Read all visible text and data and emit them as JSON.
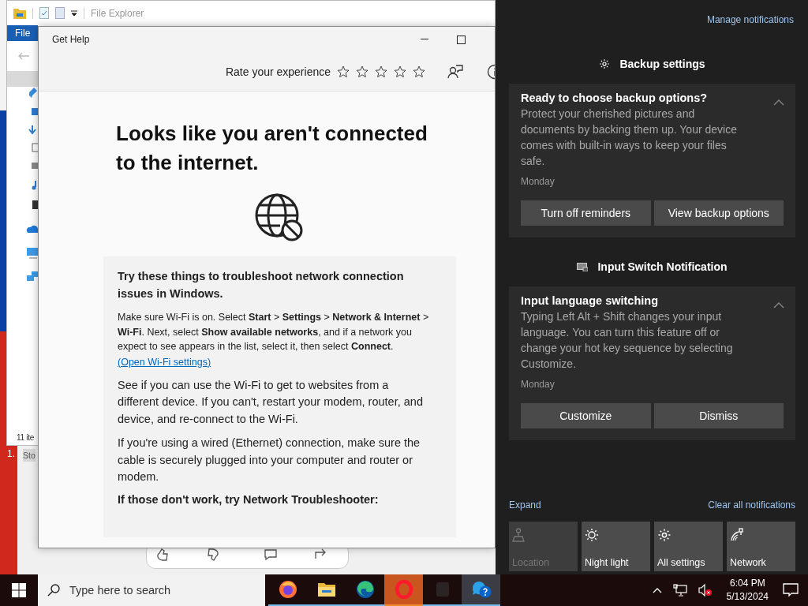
{
  "desktop": {
    "icon_label": "1."
  },
  "file_explorer": {
    "title": "File Explorer",
    "ribbon_tab": "File",
    "status": "11 ite"
  },
  "background_window": {
    "cell": "Sto"
  },
  "get_help": {
    "title": "Get Help",
    "rating": {
      "label": "Rate your experience",
      "stars": 0
    },
    "heading": "Looks like you aren't connected to the internet.",
    "card": {
      "heading": "Try these things to troubleshoot network connection issues in Windows.",
      "paragraphs": [
        {
          "kind": "small",
          "text": "Make sure Wi-Fi is on. Select **Start** > **Settings** > **Network & Internet** > **Wi-Fi**. Next, select **Show available networks**, and if a network you expect to see appears in the list, select it, then select **Connect**."
        },
        {
          "kind": "link",
          "text": "(Open Wi-Fi settings)"
        },
        {
          "kind": "body",
          "text": "See if you can use the Wi-Fi to get to websites from a different device. If you can't, restart your modem, router, and device, and re-connect to the Wi-Fi."
        },
        {
          "kind": "body",
          "text": "If you're using a wired (Ethernet) connection, make sure the cable is securely plugged into your computer and router or modem."
        },
        {
          "kind": "strong",
          "text": "If those don't work, try Network Troubleshooter:"
        }
      ]
    }
  },
  "action_center": {
    "manage": "Manage notifications",
    "groups": [
      {
        "app": "Backup settings",
        "kind": "gear",
        "notification": {
          "title": "Ready to choose backup options?",
          "body": "Protect your cherished pictures and documents by backing them up. Your device comes with built-in ways to keep your files safe.",
          "time": "Monday",
          "buttons": [
            "Turn off reminders",
            "View backup options"
          ]
        }
      },
      {
        "app": "Input Switch Notification",
        "kind": "keyboard",
        "notification": {
          "title": "Input language switching",
          "body": "Typing Left Alt + Shift changes your input language. You can turn this feature off or change your hot key sequence by selecting Customize.",
          "time": "Monday",
          "buttons": [
            "Customize",
            "Dismiss"
          ]
        }
      }
    ],
    "expand": "Expand",
    "clear": "Clear all notifications",
    "tiles": [
      {
        "label": "Location",
        "kind": "location",
        "disabled": true
      },
      {
        "label": "Night light",
        "kind": "sun",
        "disabled": false
      },
      {
        "label": "All settings",
        "kind": "gear",
        "disabled": false
      },
      {
        "label": "Network",
        "kind": "network",
        "disabled": false
      }
    ]
  },
  "taskbar": {
    "search": {
      "placeholder": "Type here to search"
    },
    "apps": [
      {
        "kind": "firefox",
        "selected": false,
        "flashing": false
      },
      {
        "kind": "folder",
        "selected": false,
        "flashing": false
      },
      {
        "kind": "edge",
        "selected": false,
        "flashing": false
      },
      {
        "kind": "opera",
        "selected": false,
        "flashing": true
      },
      {
        "kind": "generic",
        "selected": false,
        "flashing": false
      },
      {
        "kind": "help",
        "selected": true,
        "flashing": false
      }
    ],
    "time": "6:04 PM",
    "date": "5/13/2024"
  }
}
